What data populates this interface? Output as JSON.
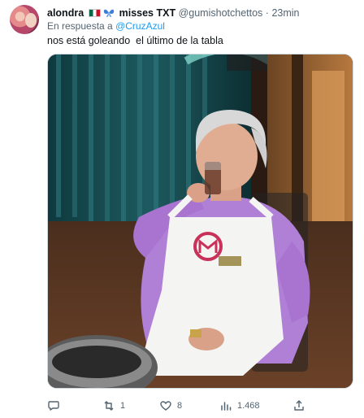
{
  "tweet": {
    "display_name": "alondra",
    "name_suffix": "misses TXT",
    "handle": "@gumishotchettos",
    "separator": "·",
    "time": "23min",
    "reply_prefix": "En respuesta a",
    "reply_to": "@CruzAzul",
    "text": "nos está goleando  el último de la tabla"
  },
  "actions": {
    "reply_count": "",
    "retweet_count": "1",
    "like_count": "8",
    "view_count": "1.468"
  },
  "icons": {
    "reply": "comment-icon",
    "retweet": "retweet-icon",
    "like": "heart-icon",
    "views": "views-chart-icon",
    "share": "share-icon"
  },
  "colors": {
    "link": "#1d9bf0",
    "secondary_text": "#536471",
    "apron_logo": "#c8325a"
  }
}
